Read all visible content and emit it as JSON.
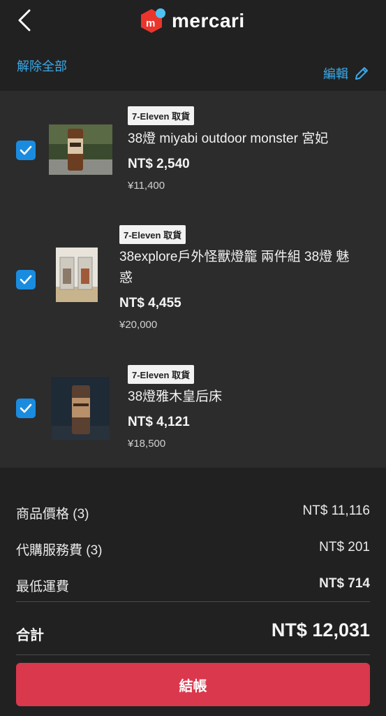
{
  "header": {
    "brand": "mercari"
  },
  "toolbar": {
    "deselect_all": "解除全部",
    "edit": "編輯"
  },
  "items": [
    {
      "badge": "7-Eleven 取貨",
      "title": "38燈 miyabi outdoor monster 宮妃",
      "price": "NT$ 2,540",
      "yen": "¥11,400",
      "checked": true
    },
    {
      "badge": "7-Eleven 取貨",
      "title": "38explore戶外怪獸燈籠 兩件組 38燈 魅惑",
      "price": "NT$ 4,455",
      "yen": "¥20,000",
      "checked": true
    },
    {
      "badge": "7-Eleven 取貨",
      "title": "38燈雅木皇后床",
      "price": "NT$ 4,121",
      "yen": "¥18,500",
      "checked": true
    }
  ],
  "summary": {
    "goods_label": "商品價格 (3)",
    "goods_value": "NT$ 11,116",
    "service_label": "代購服務費 (3)",
    "service_value": "NT$ 201",
    "shipping_label": "最低運費",
    "shipping_value": "NT$ 714",
    "total_label": "合計",
    "total_value": "NT$ 12,031"
  },
  "checkout": {
    "label": "結帳"
  },
  "colors": {
    "accent": "#3aa9e8",
    "checkbox": "#1a8ce0",
    "checkout": "#d9384d",
    "logo_red": "#ea352d",
    "logo_blue": "#4dc3f2"
  }
}
